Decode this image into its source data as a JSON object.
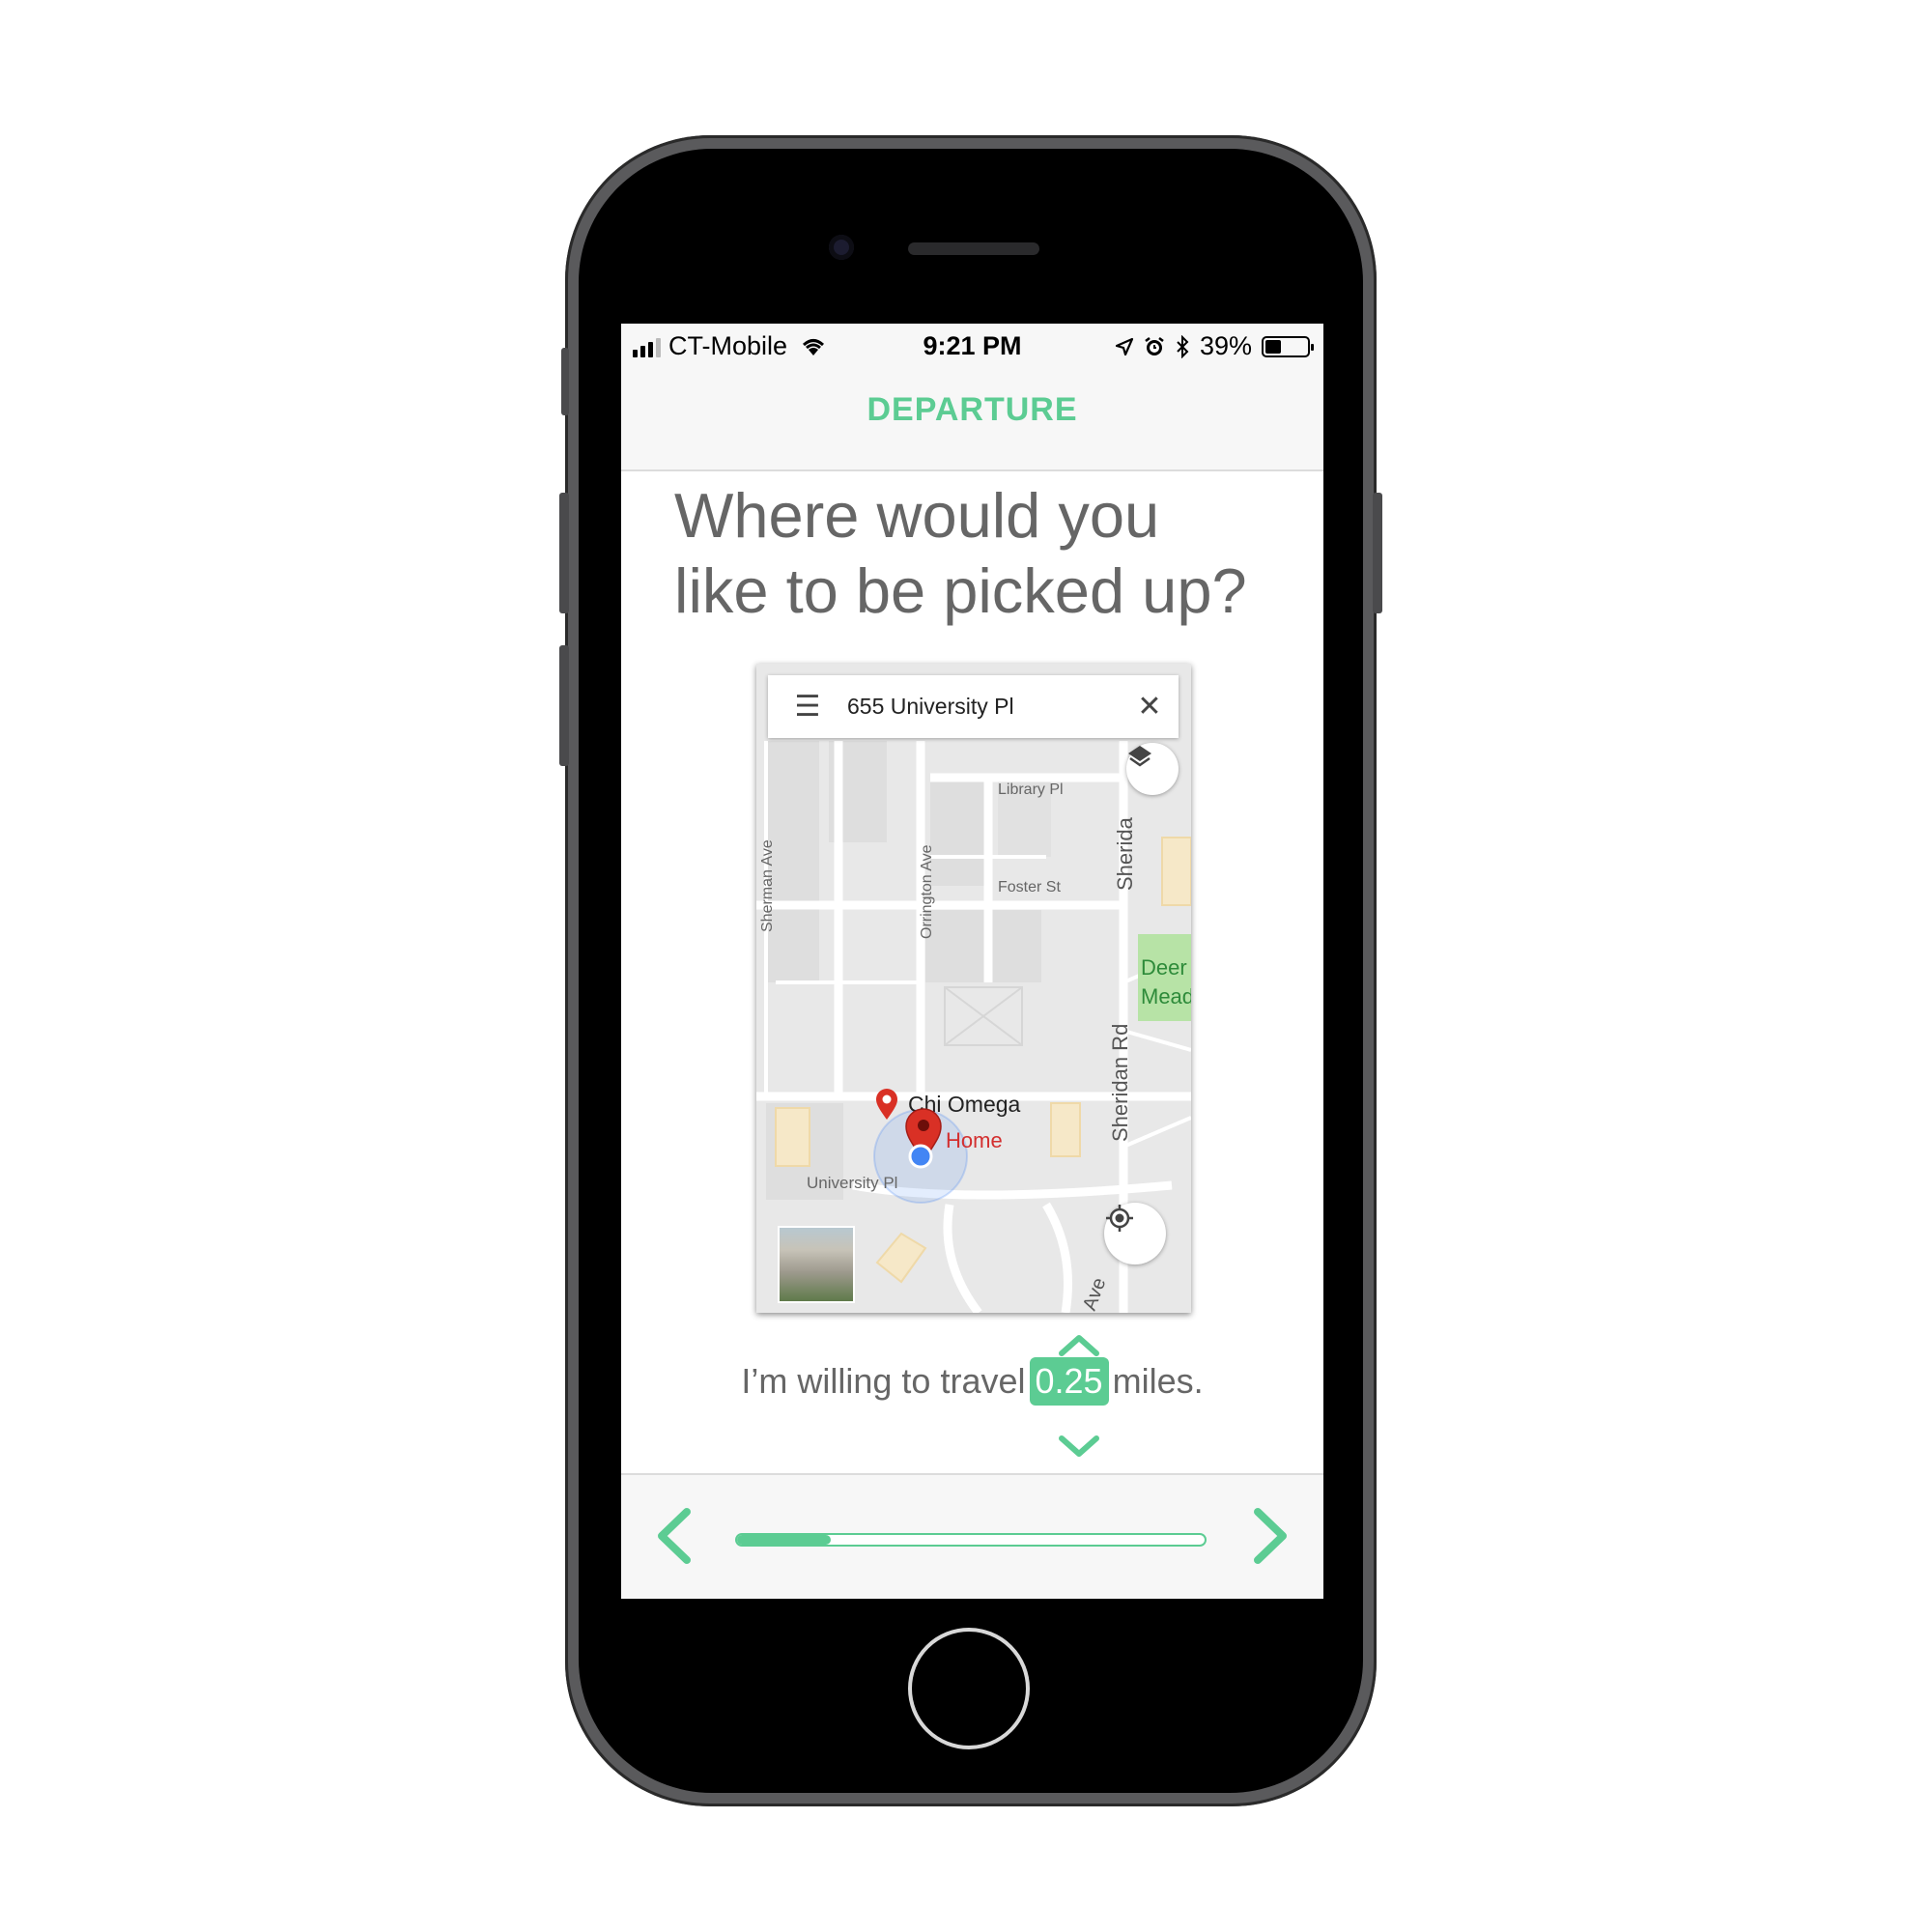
{
  "status_bar": {
    "carrier": "CT-Mobile",
    "time": "9:21 PM",
    "battery": "39%",
    "battery_level": 0.39
  },
  "nav": {
    "title": "DEPARTURE"
  },
  "question": {
    "line1": "Where would you",
    "line2": "like to be picked up?"
  },
  "map": {
    "search_text": "655 University Pl",
    "street_labels": {
      "library": "Library Pl",
      "foster": "Foster St",
      "sherman": "Sherman Ave",
      "orrington": "Orrington Ave",
      "sheridan_top": "Sherida",
      "sheridan": "Sheridan Rd",
      "university": "University Pl",
      "ave_bottom": "Ave"
    },
    "park_label_line1": "Deer",
    "park_label_line2": "Mead",
    "poi": "Chi Omega",
    "home": "Home",
    "colors": {
      "pin": "#d93025",
      "location_dot": "#4285f4",
      "park": "#b7e3a6"
    }
  },
  "travel": {
    "prefix": "I’m willing to travel",
    "value": "0.25",
    "suffix": "miles."
  },
  "progress": {
    "fraction": 0.2
  },
  "colors": {
    "accent": "#5ccc93",
    "text": "#666666"
  }
}
